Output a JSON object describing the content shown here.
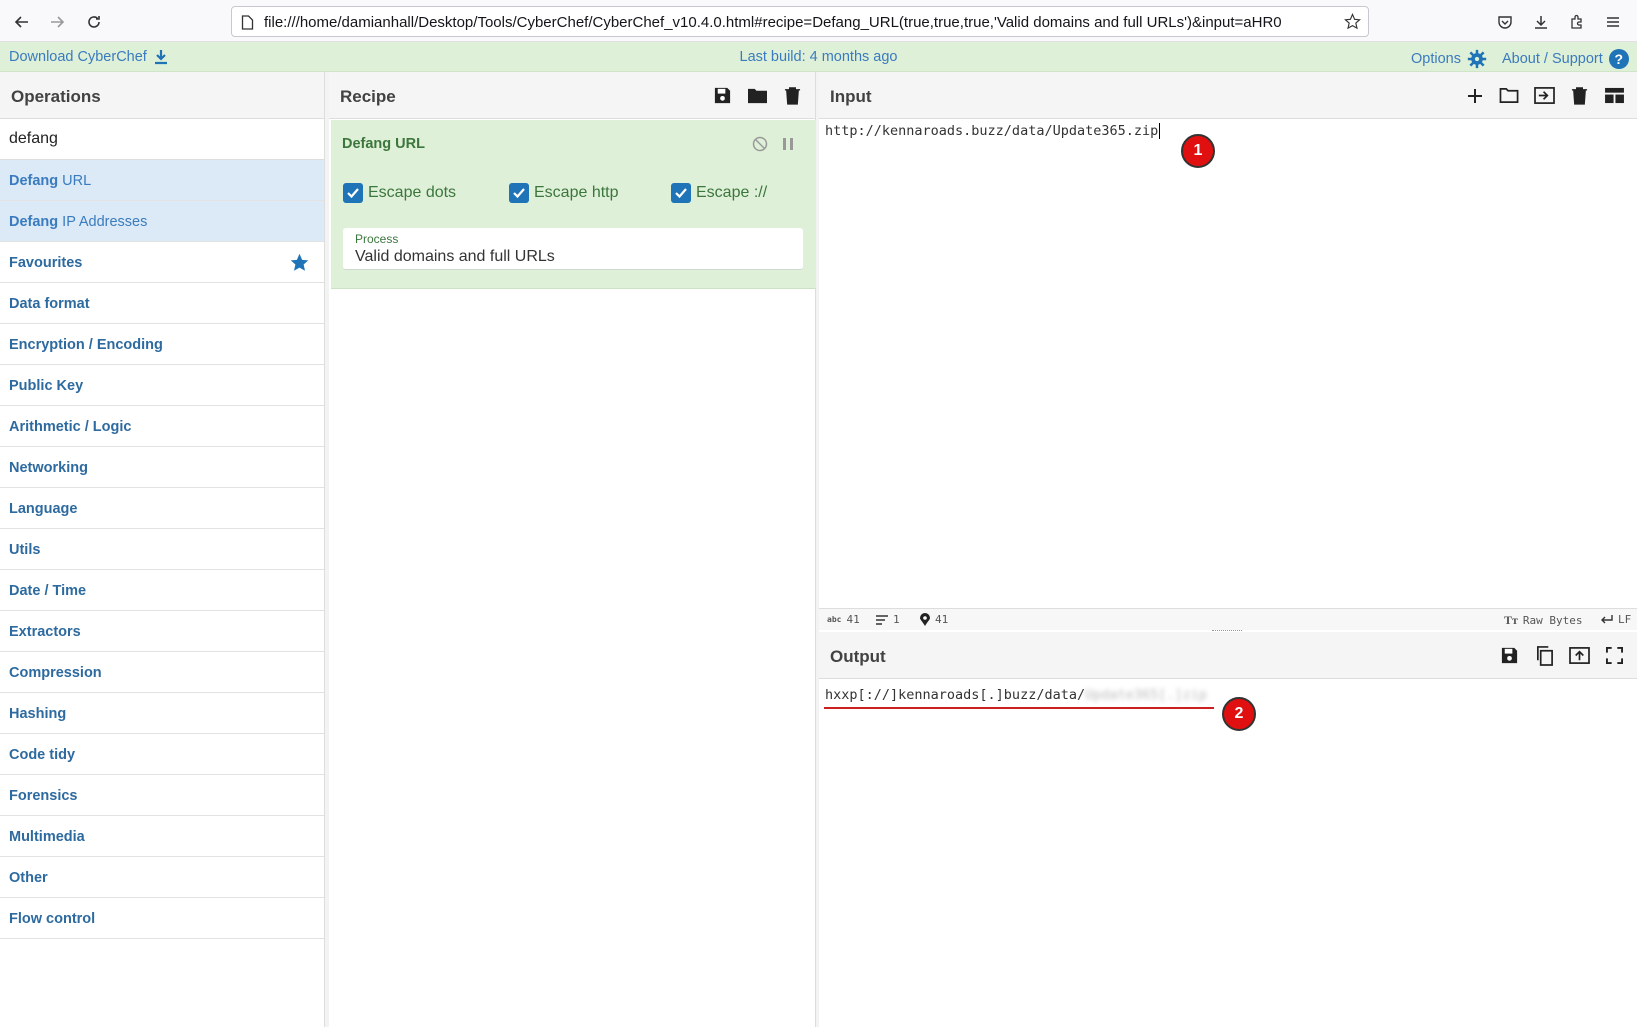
{
  "browser": {
    "url": "file:///home/damianhall/Desktop/Tools/CyberChef/CyberChef_v10.4.0.html#recipe=Defang_URL(true,true,true,'Valid domains and full URLs')&input=aHR0"
  },
  "infobar": {
    "download_label": "Download CyberChef",
    "last_build": "Last build: 4 months ago",
    "options_label": "Options",
    "about_label": "About / Support"
  },
  "operations": {
    "title": "Operations",
    "search_value": "defang",
    "results": [
      {
        "highlight": "Defang",
        "rest": " URL"
      },
      {
        "highlight": "Defang",
        "rest": " IP Addresses"
      }
    ],
    "categories": [
      "Favourites",
      "Data format",
      "Encryption / Encoding",
      "Public Key",
      "Arithmetic / Logic",
      "Networking",
      "Language",
      "Utils",
      "Date / Time",
      "Extractors",
      "Compression",
      "Hashing",
      "Code tidy",
      "Forensics",
      "Multimedia",
      "Other",
      "Flow control"
    ]
  },
  "recipe": {
    "title": "Recipe",
    "operation": {
      "name": "Defang URL",
      "checkboxes": [
        {
          "label": "Escape dots",
          "checked": true
        },
        {
          "label": "Escape http",
          "checked": true
        },
        {
          "label": "Escape ://",
          "checked": true
        }
      ],
      "process_label": "Process",
      "process_value": "Valid domains and full URLs"
    }
  },
  "input": {
    "title": "Input",
    "text": "http://kennaroads.buzz/data/Update365.zip",
    "status": {
      "length": "41",
      "lines": "1",
      "position": "41",
      "encoding": "Raw Bytes",
      "eol": "LF"
    }
  },
  "output": {
    "title": "Output",
    "text_visible": "hxxp[://]kennaroads[.]buzz/data/",
    "text_redacted": "Update365[.]zip"
  },
  "annotations": {
    "marker_1": "1",
    "marker_2": "2"
  },
  "colors": {
    "accent": "#1f73b7",
    "recipe_bg": "#dff0d8",
    "marker_red": "#e01010"
  }
}
